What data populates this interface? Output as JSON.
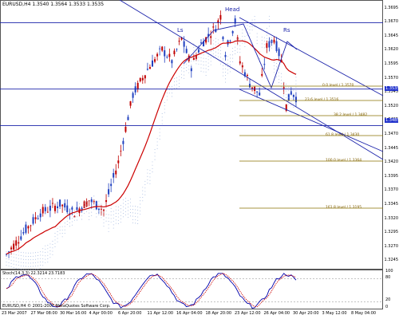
{
  "chart_title": "EURUSD,H4  1.3540 1.3564 1.3533 1.3535",
  "labels": {
    "head": "Head",
    "left_shoulder": "Ls",
    "right_shoulder": "Rs"
  },
  "fib_levels": [
    {
      "label": "0.0 level / 1.3570",
      "price": 1.357
    },
    {
      "label": "23.6 level / 1.3516",
      "price": 1.3516
    },
    {
      "label": "38.2 level / 1.3482",
      "price": 1.3482
    },
    {
      "label": "61.8 level / 1.3430",
      "price": 1.343
    },
    {
      "label": "100.0 level / 1.3364",
      "price": 1.3364
    },
    {
      "label": "161.8 level / 1.3195",
      "price": 1.3195
    }
  ],
  "price_ticks": [
    "1.3695",
    "1.3670",
    "1.3645",
    "1.3620",
    "1.3595",
    "1.3570",
    "1.3545",
    "1.3520",
    "1.3495",
    "1.3470",
    "1.3445",
    "1.3420",
    "1.3395",
    "1.3370",
    "1.3345",
    "1.3320",
    "1.3295",
    "1.3270",
    "1.3245"
  ],
  "current_price_tag": "1.3535",
  "neckline_tag": "1.3485",
  "stoch": {
    "title": "Stoch(14,3,3) 22.3214 23.7183",
    "levels": [
      "100",
      "80",
      "20",
      "0"
    ]
  },
  "copyright": "EURUSD,H4 © 2001-2007 MetaQuotes Software Corp.",
  "time_labels": [
    "23 Mar 2007",
    "27 Mar 08:00",
    "30 Mar 16:00",
    "4 Apr 00:00",
    "6 Apr 20:00",
    "11 Apr 12:00",
    "16 Apr 04:00",
    "18 Apr 20:00",
    "23 Apr 12:00",
    "26 Apr 04:00",
    "30 Apr 20:00",
    "3 May 12:00",
    "8 May 04:00"
  ],
  "colors": {
    "bull": "#1f3fbf",
    "bear": "#c00000",
    "ma": "#cc0000",
    "cloud": "#8fa8d8",
    "channel": "#1a22aa",
    "fib": "#8a7000",
    "stoch_main": "#0000aa",
    "stoch_signal": "#cc0000"
  }
}
